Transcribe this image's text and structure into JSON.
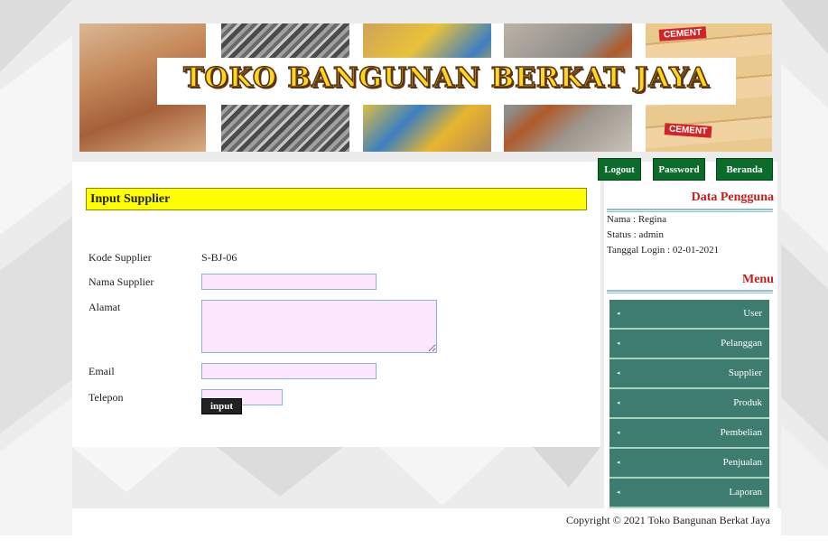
{
  "header": {
    "site_title": "TOKO BANGUNAN BERKAT JAYA",
    "cement_text": "CEMENT"
  },
  "nav": {
    "logout": "Logout",
    "password": "Password",
    "beranda": "Beranda"
  },
  "form": {
    "title": "Input Supplier",
    "kode_label": "Kode Supplier",
    "kode_value": "S-BJ-06",
    "nama_label": "Nama Supplier",
    "nama_value": "",
    "alamat_label": "Alamat",
    "alamat_value": "",
    "email_label": "Email",
    "email_value": "",
    "telepon_label": "Telepon",
    "telepon_value": "",
    "submit_label": "input"
  },
  "user": {
    "heading": "Data Pengguna",
    "nama": "Nama : Regina",
    "status": "Status : admin",
    "login": "Tanggal Login : 02-01-2021"
  },
  "menu": {
    "heading": "Menu",
    "items": [
      "User",
      "Pelanggan",
      "Supplier",
      "Produk",
      "Pembelian",
      "Penjualan",
      "Laporan"
    ]
  },
  "footer": {
    "copyright": "Copyright © 2021 Toko Bangunan Berkat Jaya"
  },
  "colors": {
    "section_title_bg": "#ffff00",
    "nav_button": "#0a6b2b",
    "menu_item": "#3f7c70",
    "side_heading": "#c81d1d",
    "input_bg": "#fce7fd"
  }
}
